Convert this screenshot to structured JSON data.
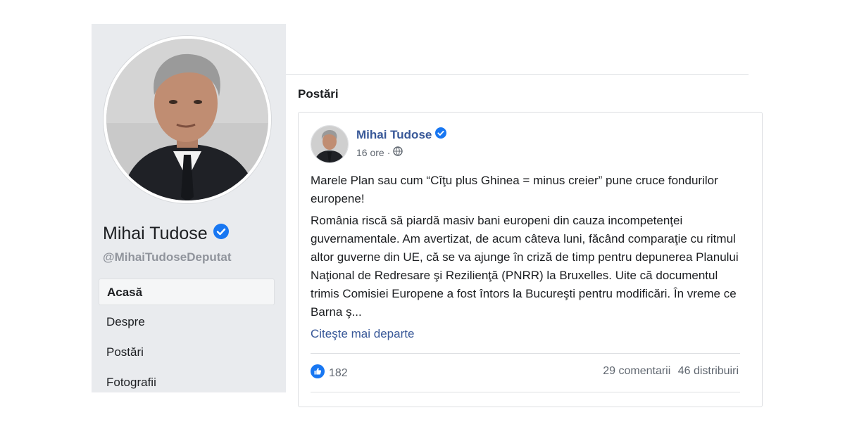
{
  "profile": {
    "name": "Mihai Tudose",
    "handle": "@MihaiTudoseDeputat"
  },
  "nav": {
    "items": [
      {
        "label": "Acasă"
      },
      {
        "label": "Despre"
      },
      {
        "label": "Postări"
      },
      {
        "label": "Fotografii"
      }
    ]
  },
  "main": {
    "section_title": "Postări"
  },
  "post": {
    "author": "Mihai Tudose",
    "time": "16 ore",
    "separator": "·",
    "privacy_icon": "globe-icon",
    "paragraph1": "Marele Plan sau cum “Cîţu plus Ghinea = minus creier” pune cruce fondurilor europene!",
    "paragraph2": "România riscă să piardă masiv bani europeni din cauza incompetenţei guvernamentale. Am avertizat, de acum câteva luni, făcând comparaţie cu ritmul altor guverne din UE, că se va ajunge în criză de timp pentru depunerea Planului Naţional de Redresare şi Rezilienţă (PNRR) la Bruxelles. Uite că documentul trimis Comisiei Europene a fost întors la Bucureşti pentru modificări. În vreme ce Barna ş...",
    "read_more": "Citeşte mai departe",
    "likes": "182",
    "comments": "29 comentarii",
    "shares": "46 distribuiri"
  },
  "colors": {
    "link_blue": "#385898",
    "verified_blue": "#1877f2",
    "sidebar_bg": "#e9ebee"
  }
}
